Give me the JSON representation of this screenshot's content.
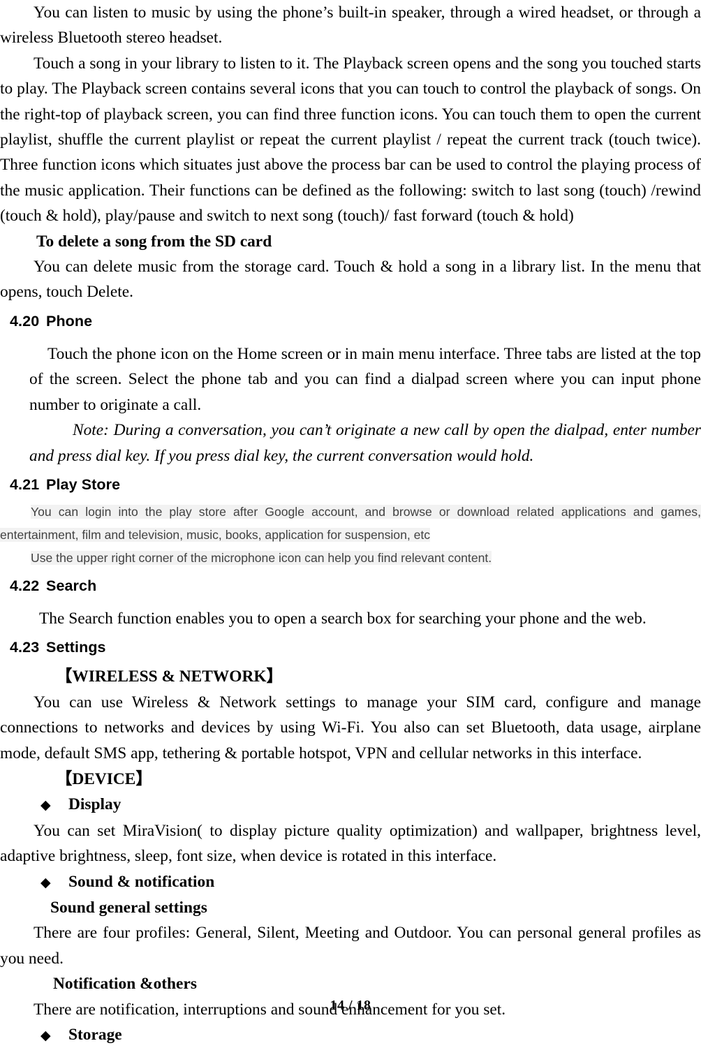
{
  "document": {
    "page_label": "14 / 18",
    "page_number": 14,
    "total_pages": 18,
    "bullet_glyph": "◆",
    "bracket_open": "【",
    "bracket_close": "】",
    "highlight_color": "#f2f2f2",
    "highlight_text_color": "#414141"
  },
  "music_section": {
    "para_speaker": "You can listen to music by using the phone’s built-in speaker, through a wired headset, or through a wireless Bluetooth stereo headset.",
    "para_playback": "Touch a song in your library to listen to it. The Playback screen opens and the song you touched starts to play. The Playback screen contains several icons that you can touch to control the playback of songs. On the right-top of playback screen, you can find three function icons. You can touch them to open the current playlist, shuffle the current playlist or repeat the current playlist / repeat the current track (touch twice). Three function icons which situates just above the process bar can be used to control the playing process of the music application. Their functions can be defined as the following: switch to last song (touch) /rewind (touch & hold), play/pause and switch to next song (touch)/ fast forward (touch & hold)",
    "delete_heading": "To delete a song from the SD card",
    "delete_body": "You can delete music from the storage card. Touch & hold a song in a library list. In the menu that opens, touch Delete."
  },
  "sections": [
    {
      "number": "4.20",
      "title": "Phone",
      "body": "Touch the phone icon on the Home screen or in main menu interface. Three tabs are listed at the top of the screen. Select the phone tab and you can find a dialpad screen where you can input phone number to originate a call.",
      "note": "Note: During a conversation, you can’t originate a new call by open the dialpad, enter number and press dial key. If you press dial key, the current conversation would hold."
    },
    {
      "number": "4.21",
      "title": "Play Store",
      "highlight_para_1": "You can login into the play store after Google account, and browse or download related applications and games, entertainment, film and television, music, books, application for suspension, etc",
      "highlight_para_2": "Use the upper right corner of the microphone icon can help you find relevant content."
    },
    {
      "number": "4.22",
      "title": "Search",
      "body": "The Search function enables you to open a search box for searching your phone and the web."
    },
    {
      "number": "4.23",
      "title": "Settings"
    }
  ],
  "settings": {
    "wireless_heading": "WIRELESS & NETWORK",
    "wireless_body": "You can use Wireless & Network settings to manage your SIM card, configure and manage connections to networks and devices by using Wi-Fi. You also can set Bluetooth, data usage, airplane mode, default SMS app, tethering & portable hotspot, VPN and cellular networks in this interface.",
    "device_heading": "DEVICE",
    "display_label": "Display",
    "display_body": "You can set MiraVision( to display picture quality optimization) and wallpaper, brightness level, adaptive brightness, sleep, font size, when device is rotated in this interface.",
    "sound_label": "Sound & notification",
    "sound_general_heading": "Sound general settings",
    "sound_general_body": "There are four profiles: General, Silent, Meeting and Outdoor. You can personal general profiles as you need.",
    "notification_heading": "Notification &others",
    "notification_body": "There are notification, interruptions and sound enhancement for you set.",
    "storage_label": "Storage"
  }
}
